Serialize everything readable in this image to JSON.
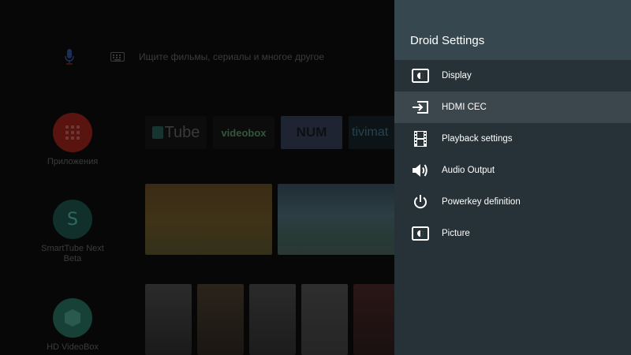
{
  "launcher": {
    "search_placeholder": "Ищите фильмы, сериалы и многое другое",
    "apps": [
      {
        "label": "Приложения"
      },
      {
        "label": "SmartTube Next Beta",
        "letter": "S"
      },
      {
        "label": "HD VideoBox"
      }
    ],
    "channels": [
      {
        "text": "Tube"
      },
      {
        "text": "videobox"
      },
      {
        "text": "NUM"
      },
      {
        "text": "tivimat"
      }
    ]
  },
  "settings": {
    "title": "Droid Settings",
    "items": [
      {
        "label": "Display",
        "icon": "display-icon"
      },
      {
        "label": "HDMI CEC",
        "icon": "hdmi-input-icon",
        "focused": true
      },
      {
        "label": "Playback settings",
        "icon": "film-strip-icon"
      },
      {
        "label": "Audio Output",
        "icon": "speaker-icon"
      },
      {
        "label": "Powerkey definition",
        "icon": "power-icon"
      },
      {
        "label": "Picture",
        "icon": "picture-icon"
      }
    ]
  },
  "colors": {
    "panel_bg": "#263238",
    "header_bg": "#37474f",
    "focus_bg": "#3b474d"
  }
}
